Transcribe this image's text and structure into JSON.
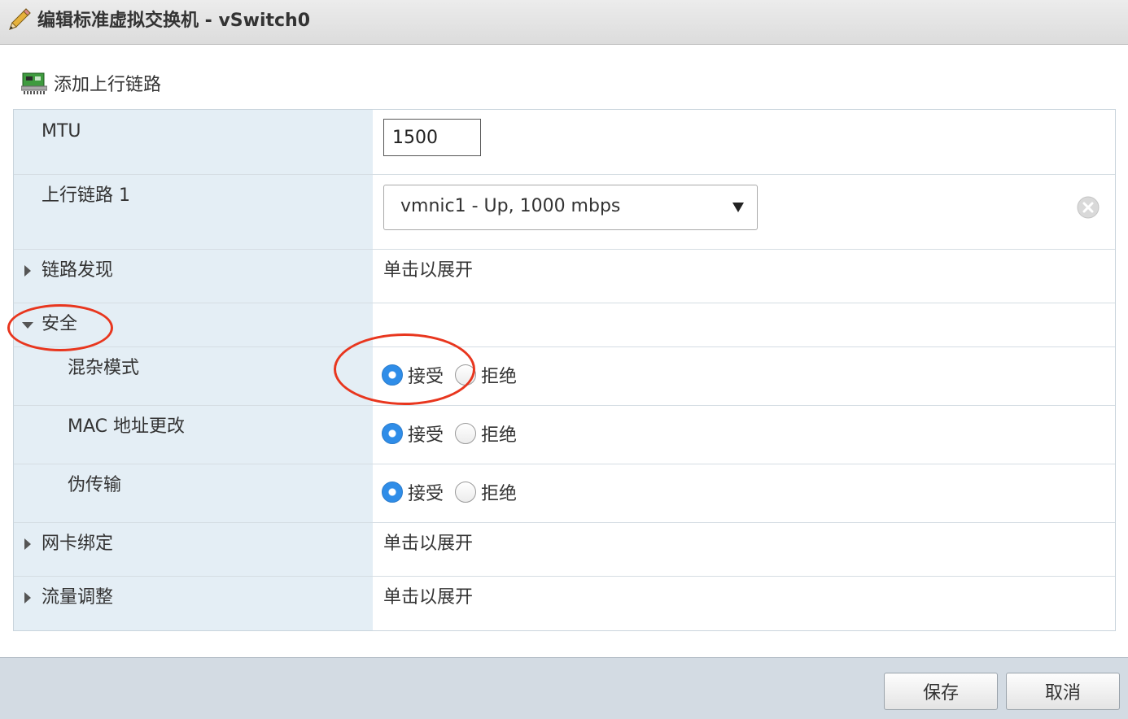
{
  "dialog": {
    "title": "编辑标准虚拟交换机 - vSwitch0",
    "title_icon": "pencil-icon"
  },
  "toolbar": {
    "add_uplink_label": "添加上行链路",
    "add_uplink_icon": "network-card-icon"
  },
  "rows": {
    "mtu": {
      "label": "MTU",
      "value": "1500"
    },
    "uplink1": {
      "label": "上行链路 1",
      "selected": "vmnic1 - Up, 1000 mbps"
    },
    "link_discovery": {
      "label": "链路发现",
      "value": "单击以展开",
      "expanded": false
    },
    "security": {
      "label": "安全",
      "expanded": true
    },
    "promiscuous": {
      "label": "混杂模式",
      "accept": "接受",
      "reject": "拒绝",
      "selected": "accept"
    },
    "mac_changes": {
      "label": "MAC 地址更改",
      "accept": "接受",
      "reject": "拒绝",
      "selected": "accept"
    },
    "forged_transmits": {
      "label": "伪传输",
      "accept": "接受",
      "reject": "拒绝",
      "selected": "accept"
    },
    "nic_teaming": {
      "label": "网卡绑定",
      "value": "单击以展开",
      "expanded": false
    },
    "traffic_shaping": {
      "label": "流量调整",
      "value": "单击以展开",
      "expanded": false
    }
  },
  "footer": {
    "save_label": "保存",
    "cancel_label": "取消"
  },
  "colors": {
    "label_column": "#e4eef5",
    "radio_selected": "#2f8de8",
    "annotation": "#e8361e",
    "footer": "#d3dbe3"
  }
}
